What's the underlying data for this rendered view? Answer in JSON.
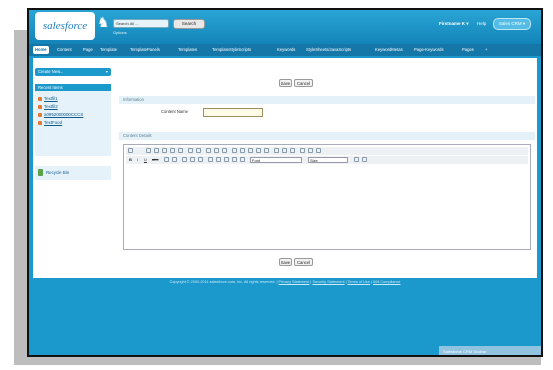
{
  "colors": {
    "header": "#1b98cc",
    "tabbar": "#1576a8",
    "section": "#e4f1f8",
    "accent_orange": "#e07a2f"
  },
  "header": {
    "logo_text": "salesforce",
    "search_placeholder": "Search All ...",
    "search_button": "Search",
    "search_option": "Options",
    "user_menu": "Firstname K ▾",
    "help": "Help",
    "app_menu": "Sales CRM ▾"
  },
  "tabs": [
    {
      "label": "Home",
      "active": true
    },
    {
      "label": "Content"
    },
    {
      "label": "Page"
    },
    {
      "label": "Template"
    },
    {
      "label": "TemplatePanels"
    },
    {
      "label": "Templates"
    },
    {
      "label": "TemplateStyleScripts"
    },
    {
      "label": "Keywords"
    },
    {
      "label": "StyleSheets/JavaScripts"
    },
    {
      "label": "KeywordMetas"
    },
    {
      "label": "Page-Keywords"
    },
    {
      "label": "Pages"
    },
    {
      "label": "+"
    }
  ],
  "sidebar": {
    "create_new": "Create New...",
    "recent_title": "Recent Items",
    "recent_items": [
      "Textfil1",
      "Textfil2",
      "a0952000000CCCS",
      "TextFood"
    ],
    "recycle_bin": "Recycle Bin"
  },
  "form": {
    "save": "Save",
    "cancel": "Cancel",
    "section_info": "Information",
    "content_name_label": "Content Name",
    "content_name_value": "",
    "section_content": "Content Details",
    "font_label": "Font",
    "size_label": "Size"
  },
  "footer": {
    "text": "Copyright © 2000-2011 salesforce.com, inc. All rights reserved. |",
    "privacy": "Privacy Statement",
    "security": "Security Statement",
    "terms": "Terms of Use",
    "compliance": "508 Compliance"
  },
  "corner_badge": "Salesforce CRM Toolbar"
}
